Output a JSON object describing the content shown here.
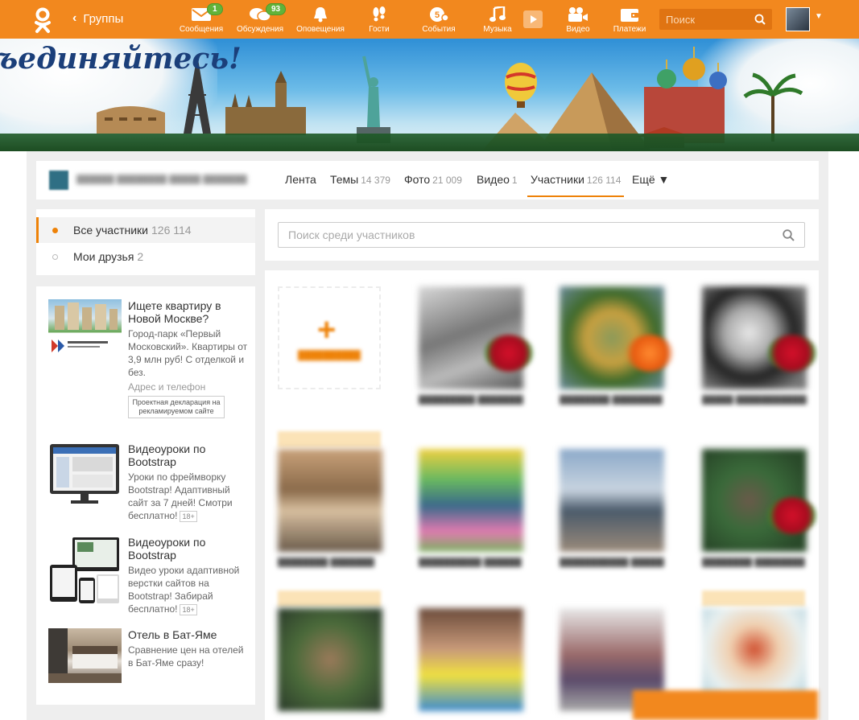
{
  "topbar": {
    "back_label": "Группы",
    "nav": [
      {
        "label": "Сообщения",
        "icon": "envelope-icon",
        "badge": "1"
      },
      {
        "label": "Обсуждения",
        "icon": "discussions-icon",
        "badge": "93"
      },
      {
        "label": "Оповещения",
        "icon": "bell-icon"
      },
      {
        "label": "Гости",
        "icon": "footprints-icon"
      },
      {
        "label": "События",
        "icon": "events-icon"
      },
      {
        "label": "Музыка",
        "icon": "music-note-icon"
      },
      {
        "label": "Видео",
        "icon": "video-camera-icon"
      },
      {
        "label": "Платежи",
        "icon": "wallet-icon"
      }
    ],
    "search_placeholder": "Поиск"
  },
  "banner": {
    "slogan": "ъединяйтесь!"
  },
  "group_nav": {
    "tabs": [
      {
        "label": "Лента",
        "count": ""
      },
      {
        "label": "Темы",
        "count": "14 379"
      },
      {
        "label": "Фото",
        "count": "21 009"
      },
      {
        "label": "Видео",
        "count": "1"
      },
      {
        "label": "Участники",
        "count": "126 114"
      },
      {
        "label": "Ещё ▼",
        "count": ""
      }
    ]
  },
  "filters": [
    {
      "label": "Все участники",
      "count": "126 114",
      "active": true
    },
    {
      "label": "Мои друзья",
      "count": "2",
      "active": false
    }
  ],
  "ads": [
    {
      "title": "Ищете квартиру в Новой Москве?",
      "text": "Город-парк «Первый Московский». Квартиры от 3,9 млн руб! С отделкой и без.",
      "link": "Адрес и телефон",
      "declaration": "Проектная декларация на рекламируемом сайте"
    },
    {
      "title": "Видеоуроки по Bootstrap",
      "text": "Уроки по фреймворку Bootstrap! Адаптивный сайт за 7 дней! Смотри бесплатно!",
      "age": "18+"
    },
    {
      "title": "Видеоуроки по Bootstrap",
      "text": "Видео уроки адаптивной верстки сайтов на Bootstrap! Забирай бесплатно!",
      "age": "18+"
    },
    {
      "title": "Отель в Бат-Яме",
      "text": "Сравнение цен на отелей в Бат-Яме сразу!"
    }
  ],
  "member_search": {
    "placeholder": "Поиск среди участников"
  },
  "colors": {
    "brand": "#f2881e",
    "accent": "#ee8208",
    "badge": "#61b33a"
  }
}
